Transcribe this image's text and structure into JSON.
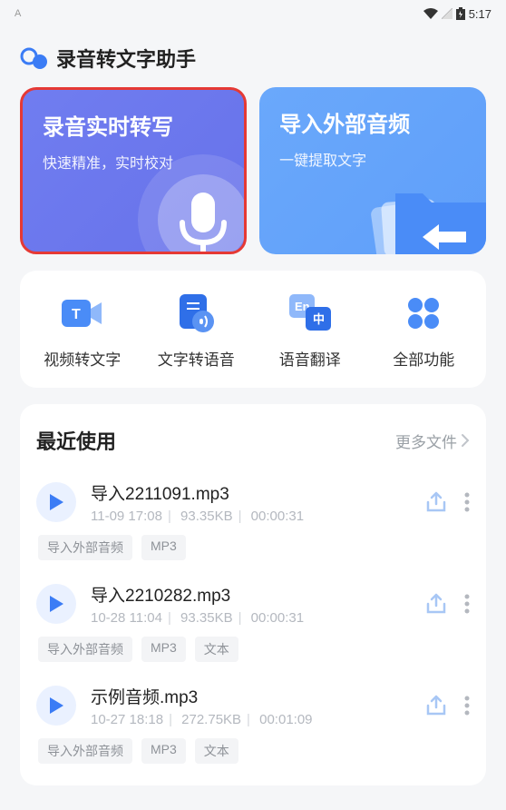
{
  "status": {
    "left": "A",
    "time": "5:17"
  },
  "app_title": "录音转文字助手",
  "hero": {
    "left": {
      "title": "录音实时转写",
      "sub": "快速精准，实时校对"
    },
    "right": {
      "title": "导入外部音频",
      "sub": "一键提取文字"
    }
  },
  "features": [
    {
      "label": "视频转文字"
    },
    {
      "label": "文字转语音"
    },
    {
      "label": "语音翻译"
    },
    {
      "label": "全部功能"
    }
  ],
  "recent": {
    "title": "最近使用",
    "more": "更多文件",
    "items": [
      {
        "name": "导入2211091.mp3",
        "time": "11-09 17:08",
        "size": "93.35KB",
        "dur": "00:00:31",
        "tags": [
          "导入外部音频",
          "MP3"
        ]
      },
      {
        "name": "导入2210282.mp3",
        "time": "10-28 11:04",
        "size": "93.35KB",
        "dur": "00:00:31",
        "tags": [
          "导入外部音频",
          "MP3",
          "文本"
        ]
      },
      {
        "name": "示例音频.mp3",
        "time": "10-27 18:18",
        "size": "272.75KB",
        "dur": "00:01:09",
        "tags": [
          "导入外部音频",
          "MP3",
          "文本"
        ]
      }
    ]
  }
}
